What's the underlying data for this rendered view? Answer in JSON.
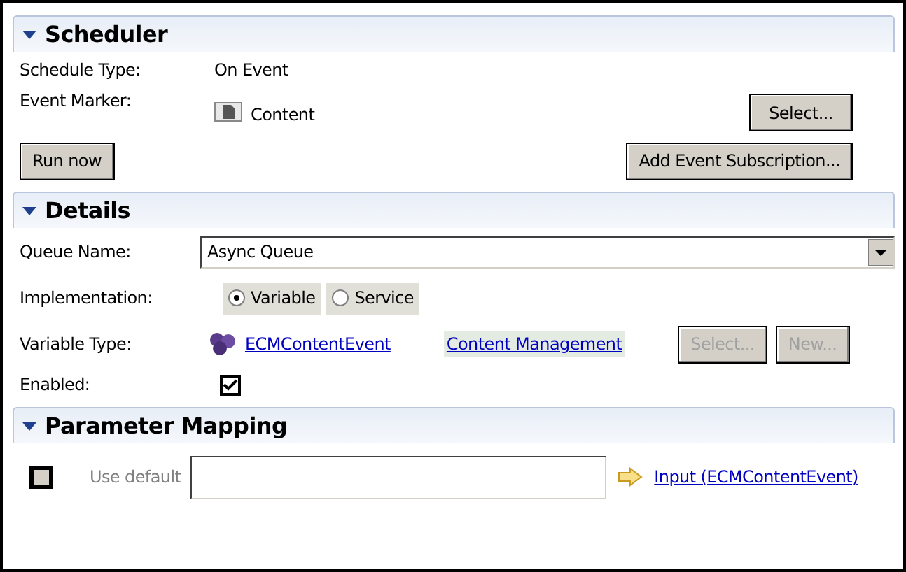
{
  "scheduler": {
    "title": "Scheduler",
    "expanded": true,
    "schedule_type": {
      "label": "Schedule Type:",
      "value": "On Event"
    },
    "event_marker": {
      "label": "Event Marker:",
      "value": "Content",
      "button": "Select..."
    },
    "run_now_button": "Run now",
    "add_subscription_button": "Add Event Subscription..."
  },
  "details": {
    "title": "Details",
    "expanded": true,
    "queue_name": {
      "label": "Queue Name:",
      "value": "Async Queue"
    },
    "implementation": {
      "label": "Implementation:",
      "options": [
        {
          "label": "Variable",
          "selected": true
        },
        {
          "label": "Service",
          "selected": false
        }
      ]
    },
    "variable_type": {
      "label": "Variable Type:",
      "link": "ECMContentEvent",
      "module_link": "Content Management",
      "buttons": [
        {
          "label": "Select...",
          "disabled": true
        },
        {
          "label": "New...",
          "disabled": true
        }
      ]
    },
    "enabled": {
      "label": "Enabled:",
      "checked": true
    }
  },
  "parameter_mapping": {
    "title": "Parameter Mapping",
    "expanded": true,
    "rows": [
      {
        "checked": false,
        "default_label": "Use default",
        "link": "Input (ECMContentEvent)"
      }
    ]
  }
}
